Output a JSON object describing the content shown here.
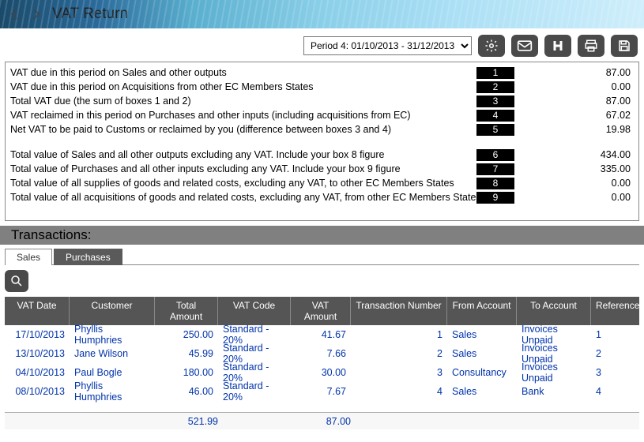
{
  "header": {
    "title": "VAT Return"
  },
  "period": {
    "selected": "Period 4: 01/10/2013 - 31/12/2013"
  },
  "boxes": [
    {
      "label": "VAT due in this period on Sales and other outputs",
      "num": "1",
      "value": "87.00"
    },
    {
      "label": "VAT due in this period on Acquisitions from other EC Members States",
      "num": "2",
      "value": "0.00"
    },
    {
      "label": "Total VAT due (the sum of boxes 1 and 2)",
      "num": "3",
      "value": "87.00"
    },
    {
      "label": "VAT reclaimed in this period on Purchases and other inputs (including acquisitions from EC)",
      "num": "4",
      "value": "67.02"
    },
    {
      "label": "Net VAT to be paid to Customs or reclaimed by you (difference between boxes 3 and 4)",
      "num": "5",
      "value": "19.98"
    }
  ],
  "boxes2": [
    {
      "label": "Total value of Sales and all other outputs excluding any VAT. Include your box 8 figure",
      "num": "6",
      "value": "434.00"
    },
    {
      "label": "Total value of Purchases and all other inputs excluding any VAT. Include your box 9 figure",
      "num": "7",
      "value": "335.00"
    },
    {
      "label": "Total value of all supplies of goods and related costs, excluding any VAT, to other EC Members States",
      "num": "8",
      "value": "0.00"
    },
    {
      "label": "Total value of all acquisitions of goods and related costs, excluding any VAT, from other EC Members States",
      "num": "9",
      "value": "0.00"
    }
  ],
  "transactions": {
    "title": "Transactions:",
    "tabs": {
      "sales": "Sales",
      "purchases": "Purchases"
    },
    "columns": {
      "date": "VAT Date",
      "customer": "Customer",
      "total": "Total Amount",
      "code": "VAT Code",
      "vat": "VAT Amount",
      "tno": "Transaction Number",
      "from": "From Account",
      "to": "To Account",
      "ref": "Reference"
    },
    "rows": [
      {
        "date": "17/10/2013",
        "customer": "Phyllis Humphries",
        "total": "250.00",
        "code": "Standard - 20%",
        "vat": "41.67",
        "tno": "1",
        "from": "Sales",
        "to": "Invoices Unpaid",
        "ref": "1"
      },
      {
        "date": "13/10/2013",
        "customer": "Jane Wilson",
        "total": "45.99",
        "code": "Standard - 20%",
        "vat": "7.66",
        "tno": "2",
        "from": "Sales",
        "to": "Invoices Unpaid",
        "ref": "2"
      },
      {
        "date": "04/10/2013",
        "customer": "Paul Bogle",
        "total": "180.00",
        "code": "Standard - 20%",
        "vat": "30.00",
        "tno": "3",
        "from": "Consultancy",
        "to": "Invoices Unpaid",
        "ref": "3"
      },
      {
        "date": "08/10/2013",
        "customer": "Phyllis Humphries",
        "total": "46.00",
        "code": "Standard - 20%",
        "vat": "7.67",
        "tno": "4",
        "from": "Sales",
        "to": "Bank",
        "ref": "4"
      }
    ],
    "totals": {
      "total": "521.99",
      "vat": "87.00"
    }
  }
}
